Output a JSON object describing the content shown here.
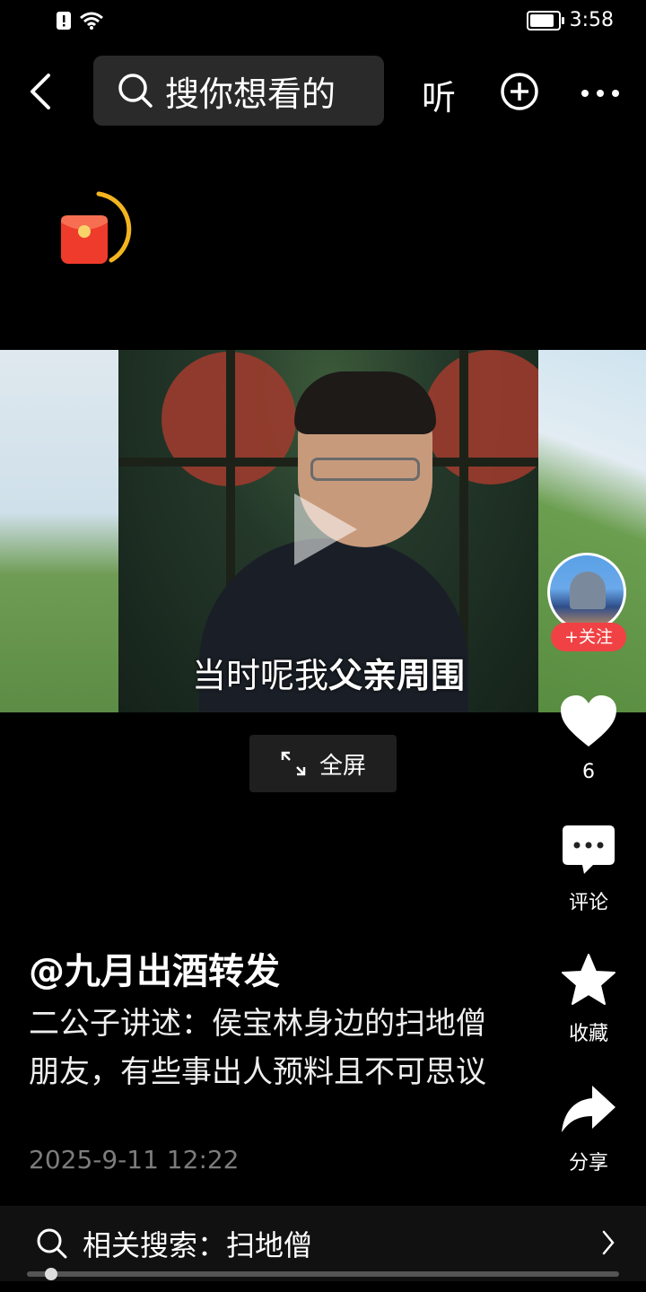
{
  "status_bar": {
    "time": "3:58",
    "icons": [
      "alert-icon",
      "wifi-icon",
      "battery-icon"
    ]
  },
  "header": {
    "search_placeholder": "搜你想看的",
    "listen_label": "听",
    "icons": [
      "back-icon",
      "search-icon",
      "plus-circle-icon",
      "more-icon"
    ]
  },
  "video": {
    "subtitle_normal": "当时呢我",
    "subtitle_bold": "父亲周围",
    "fullscreen_label": "全屏"
  },
  "author_panel": {
    "follow_label": "+关注"
  },
  "actions": {
    "like_count": "6",
    "comment_label": "评论",
    "favorite_label": "收藏",
    "share_label": "分享"
  },
  "post": {
    "author": "@九月出酒转发",
    "description": "二公子讲述：侯宝林身边的扫地僧朋友，有些事出人预料且不可思议",
    "date": "2025-9-11 12:22"
  },
  "related_search": {
    "label": "相关搜索：扫地僧"
  },
  "colors": {
    "accent_red": "#f04245",
    "background": "#000000"
  }
}
